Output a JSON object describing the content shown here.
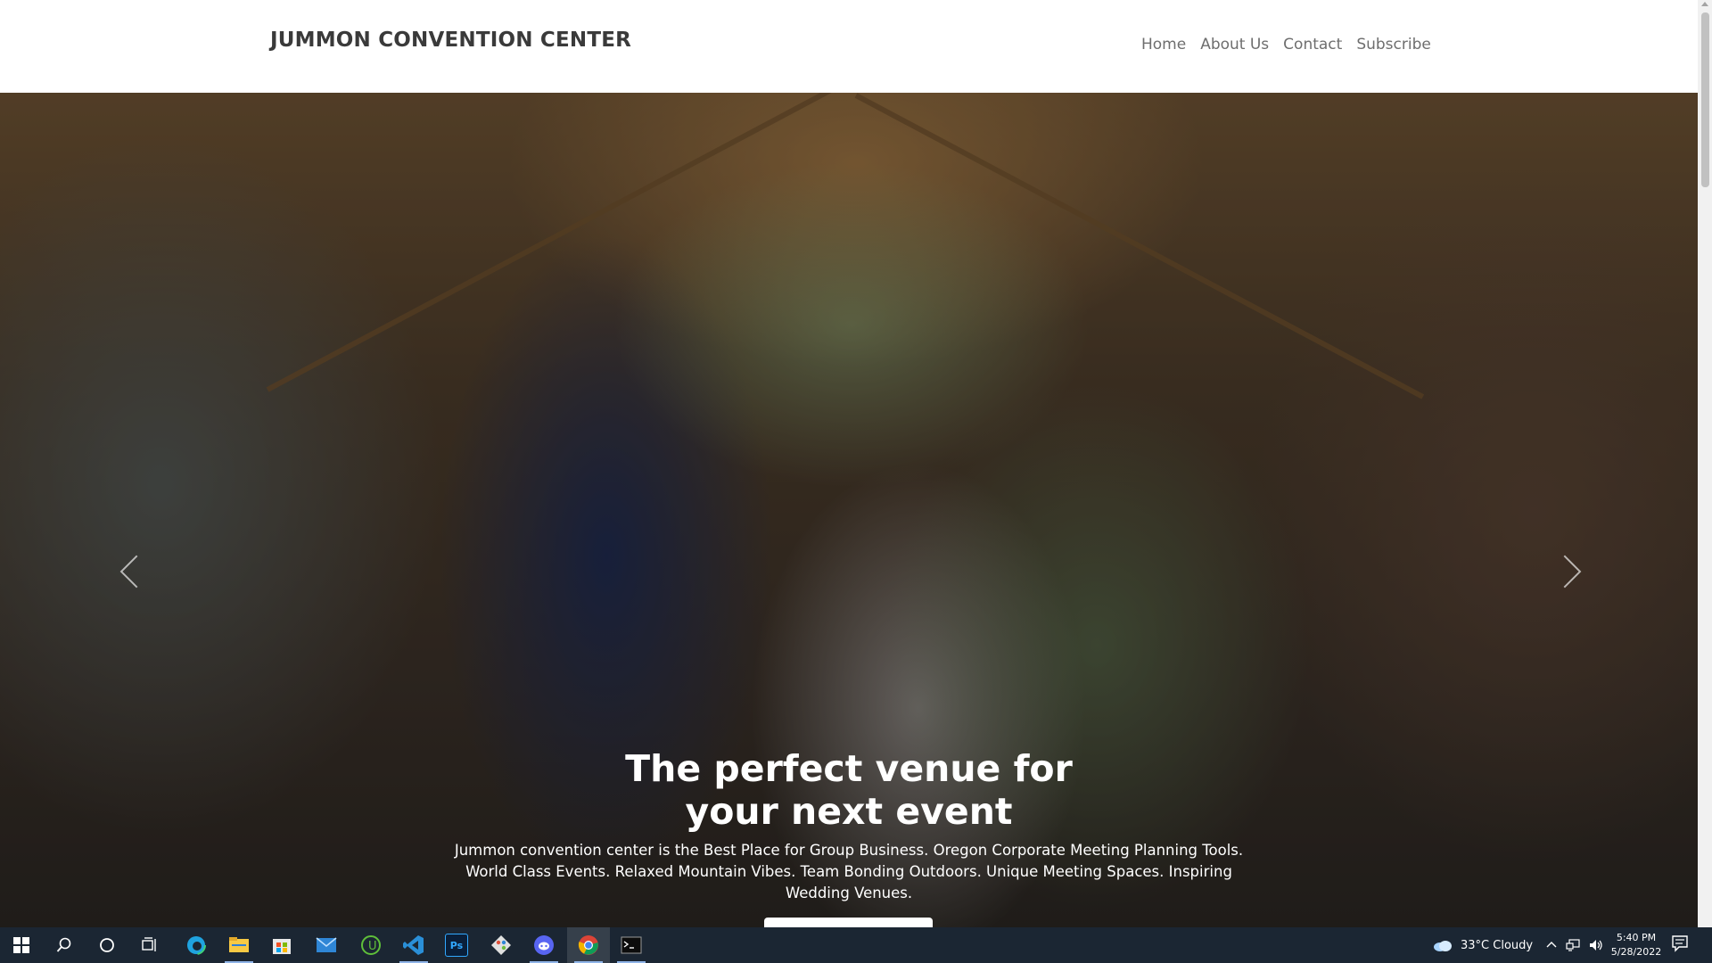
{
  "site": {
    "brand": "JUMMON CONVENTION CENTER",
    "nav": [
      "Home",
      "About Us",
      "Contact",
      "Subscribe"
    ]
  },
  "hero": {
    "title": "The perfect venue for your next event",
    "text": "Jummon convention center is the Best Place for Group Business. Oregon Corporate Meeting Planning Tools. World Class Events. Relaxed Mountain Vibes. Team Bonding Outdoors. Unique Meeting Spaces. Inspiring Wedding Venues."
  },
  "taskbar": {
    "apps": [
      "start-icon",
      "search-icon",
      "cortana-icon",
      "task-view-icon",
      "edge-icon",
      "file-explorer-icon",
      "store-icon",
      "mail-icon",
      "upwork-icon",
      "vscode-icon",
      "photoshop-icon",
      "git-icon",
      "discord-icon",
      "chrome-icon",
      "terminal-icon"
    ],
    "weather": "33°C  Cloudy",
    "time": "5:40 PM",
    "date": "5/28/2022"
  },
  "colors": {
    "brand_text": "#3a3a3a",
    "nav_text": "#6e6e6e",
    "taskbar_bg": "#1b2633",
    "hero_text": "#ffffff"
  }
}
